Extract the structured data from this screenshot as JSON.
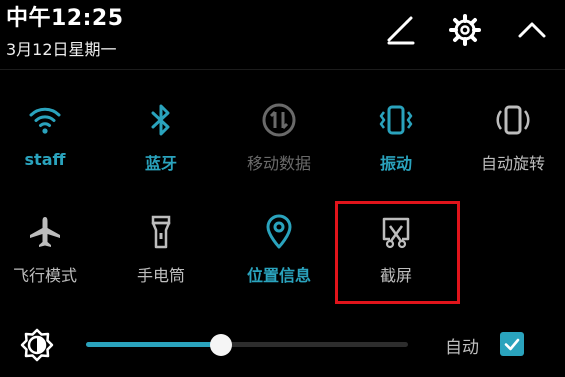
{
  "header": {
    "time": "中午12:25",
    "date": "3月12日星期一",
    "edit_icon": "pencil-icon",
    "settings_icon": "gear-icon",
    "collapse_icon": "chevron-up-icon"
  },
  "tiles": [
    {
      "label": "staff",
      "icon": "wifi-icon",
      "state": "on"
    },
    {
      "label": "蓝牙",
      "icon": "bluetooth-icon",
      "state": "on"
    },
    {
      "label": "移动数据",
      "icon": "mobile-data-icon",
      "state": "disabled"
    },
    {
      "label": "振动",
      "icon": "vibrate-icon",
      "state": "on"
    },
    {
      "label": "自动旋转",
      "icon": "auto-rotate-icon",
      "state": "off"
    },
    {
      "label": "飞行模式",
      "icon": "airplane-icon",
      "state": "off"
    },
    {
      "label": "手电筒",
      "icon": "flashlight-icon",
      "state": "off"
    },
    {
      "label": "位置信息",
      "icon": "location-icon",
      "state": "on"
    },
    {
      "label": "截屏",
      "icon": "screenshot-icon",
      "state": "off"
    }
  ],
  "brightness": {
    "icon": "brightness-icon",
    "level": 0.42,
    "auto_label": "自动",
    "auto_checked": true
  },
  "colors": {
    "accent": "#2aa3bd",
    "highlight_box": "#e0141b",
    "background": "#000000"
  }
}
